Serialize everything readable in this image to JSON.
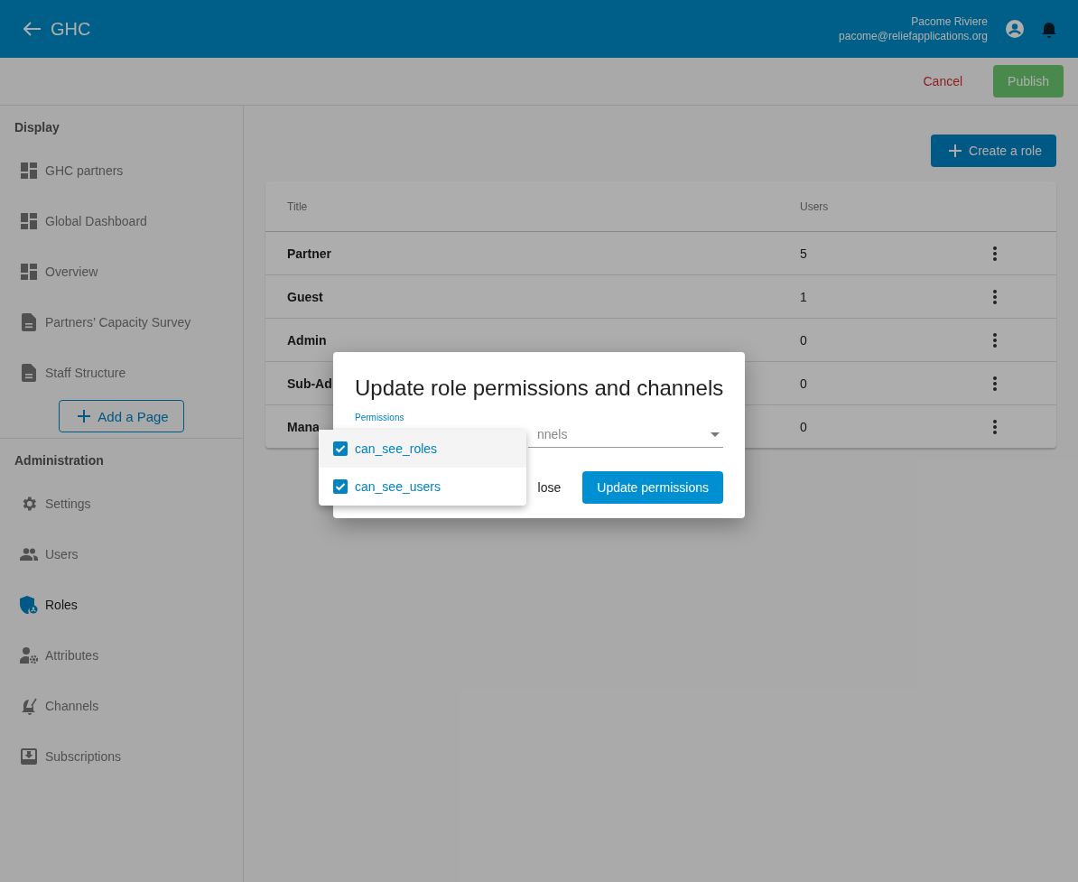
{
  "header": {
    "title": "GHC",
    "user_name": "Pacome Riviere",
    "user_email": "pacome@reliefapplications.org"
  },
  "actions": {
    "cancel": "Cancel",
    "publish": "Publish"
  },
  "sidebar": {
    "sections": [
      {
        "title": "Display",
        "add_button": "Add a Page",
        "items": [
          {
            "label": "GHC partners",
            "kind": "dashboard",
            "selected": false
          },
          {
            "label": "Global Dashboard",
            "kind": "dashboard",
            "selected": false
          },
          {
            "label": "Overview",
            "kind": "dashboard",
            "selected": false
          },
          {
            "label": "Partners’ Capacity Survey",
            "kind": "page",
            "selected": false
          },
          {
            "label": "Staff Structure",
            "kind": "page",
            "selected": false
          }
        ]
      },
      {
        "title": "Administration",
        "items": [
          {
            "label": "Settings",
            "kind": "settings",
            "selected": false
          },
          {
            "label": "Users",
            "kind": "users",
            "selected": false
          },
          {
            "label": "Roles",
            "kind": "roles",
            "selected": true
          },
          {
            "label": "Attributes",
            "kind": "attributes",
            "selected": false
          },
          {
            "label": "Channels",
            "kind": "channels",
            "selected": false
          },
          {
            "label": "Subscriptions",
            "kind": "subscriptions",
            "selected": false
          }
        ]
      }
    ]
  },
  "create_button": "Create a role",
  "table": {
    "columns": [
      "Title",
      "Users"
    ],
    "rows": [
      {
        "title": "Partner",
        "users": "5"
      },
      {
        "title": "Guest",
        "users": "1"
      },
      {
        "title": "Admin",
        "users": "0"
      },
      {
        "title": "Sub-Ad",
        "users": "0"
      },
      {
        "title": "Mana",
        "users": "0"
      }
    ]
  },
  "dialog": {
    "title": "Update role permissions and channels",
    "permissions_label": "Permissions",
    "channels_placeholder": "nnels",
    "close": "lose",
    "submit": "Update permissions",
    "options": [
      {
        "label": "can_see_roles",
        "checked": true,
        "active": true
      },
      {
        "label": "can_see_users",
        "checked": true,
        "active": false
      }
    ]
  }
}
